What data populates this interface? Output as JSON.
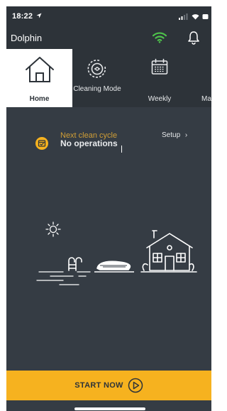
{
  "status_bar": {
    "time": "18:22"
  },
  "header": {
    "title": "Dolphin"
  },
  "tabs": [
    {
      "label": "Home",
      "icon": "house-icon",
      "active": true
    },
    {
      "label": "Cleaning Mode",
      "icon": "robot-cleaner-icon",
      "active": false
    },
    {
      "label": "Weekly",
      "icon": "calendar-icon",
      "active": false
    },
    {
      "label": "Ma",
      "icon": "partial-tab",
      "active": false
    }
  ],
  "cycle": {
    "label": "Next clean cycle",
    "status": "No operations",
    "setup_label": "Setup",
    "setup_chevron": "›"
  },
  "start_button": {
    "label": "START NOW"
  },
  "colors": {
    "background": "#353c44",
    "header": "#2d3339",
    "accent": "#f6b21f",
    "wifi": "#4ec24b",
    "cycle_label": "#d09e36"
  }
}
